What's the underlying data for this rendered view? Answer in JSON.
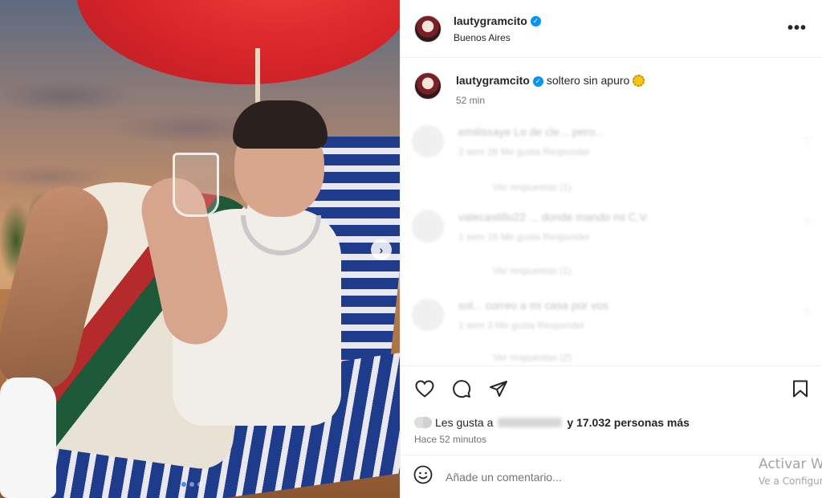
{
  "post": {
    "username": "lautygramcito",
    "location": "Buenos Aires",
    "more_label": "•••",
    "next_label": "›"
  },
  "caption": {
    "username": "lautygramcito",
    "text": "soltero sin apuro",
    "emoji": "sun",
    "time": "52 min"
  },
  "comments": [
    {
      "text": "emilissaye Lo de cle... pero...",
      "meta": "2 sem  28 Me gusta  Responder",
      "replies": "Ver respuestas (1)"
    },
    {
      "text": "valecastillo22 ... donde mando mi C.V.",
      "meta": "1 sem  16 Me gusta  Responder",
      "replies": "Ver respuestas (1)"
    },
    {
      "text": "sol... correo a mi casa por vos",
      "meta": "1 sem  3 Me gusta  Responder",
      "replies": "Ver respuestas (2)"
    }
  ],
  "actions": {
    "icons": [
      "heart-icon",
      "comment-icon",
      "share-icon",
      "bookmark-icon"
    ]
  },
  "likes": {
    "prefix": "Les gusta a",
    "count_text": "y 17.032 personas más",
    "count": 17032
  },
  "timestamp": "Hace 52 minutos",
  "composer": {
    "placeholder": "Añade un comentario..."
  },
  "watermark": {
    "title": "Activar W",
    "subtitle": "Ve a Configur"
  },
  "colors": {
    "verified": "#0095f6",
    "text": "#262626",
    "muted": "#737373",
    "border": "#efefef"
  }
}
